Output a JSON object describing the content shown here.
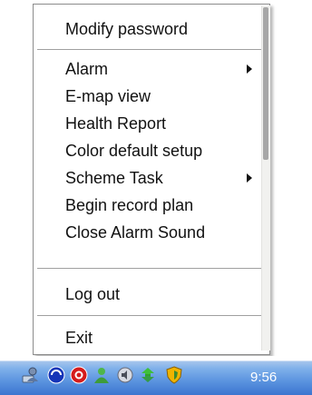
{
  "context_menu": {
    "items": [
      {
        "label": "Modify password",
        "has_submenu": false
      },
      {
        "label": "Alarm",
        "has_submenu": true
      },
      {
        "label": "E-map view",
        "has_submenu": false
      },
      {
        "label": "Health Report",
        "has_submenu": false
      },
      {
        "label": "Color default setup",
        "has_submenu": false
      },
      {
        "label": "Scheme Task",
        "has_submenu": true
      },
      {
        "label": "Begin record plan",
        "has_submenu": false
      },
      {
        "label": "Close Alarm Sound",
        "has_submenu": false
      },
      {
        "label": "Log out",
        "has_submenu": false
      },
      {
        "label": "Exit",
        "has_submenu": false
      }
    ]
  },
  "taskbar": {
    "clock": "9:56",
    "tray_icons": [
      "network-user-icon",
      "blue-circle-app-icon",
      "red-circle-app-icon",
      "green-user-icon",
      "speaker-icon",
      "green-arrows-icon",
      "shield-icon"
    ]
  }
}
